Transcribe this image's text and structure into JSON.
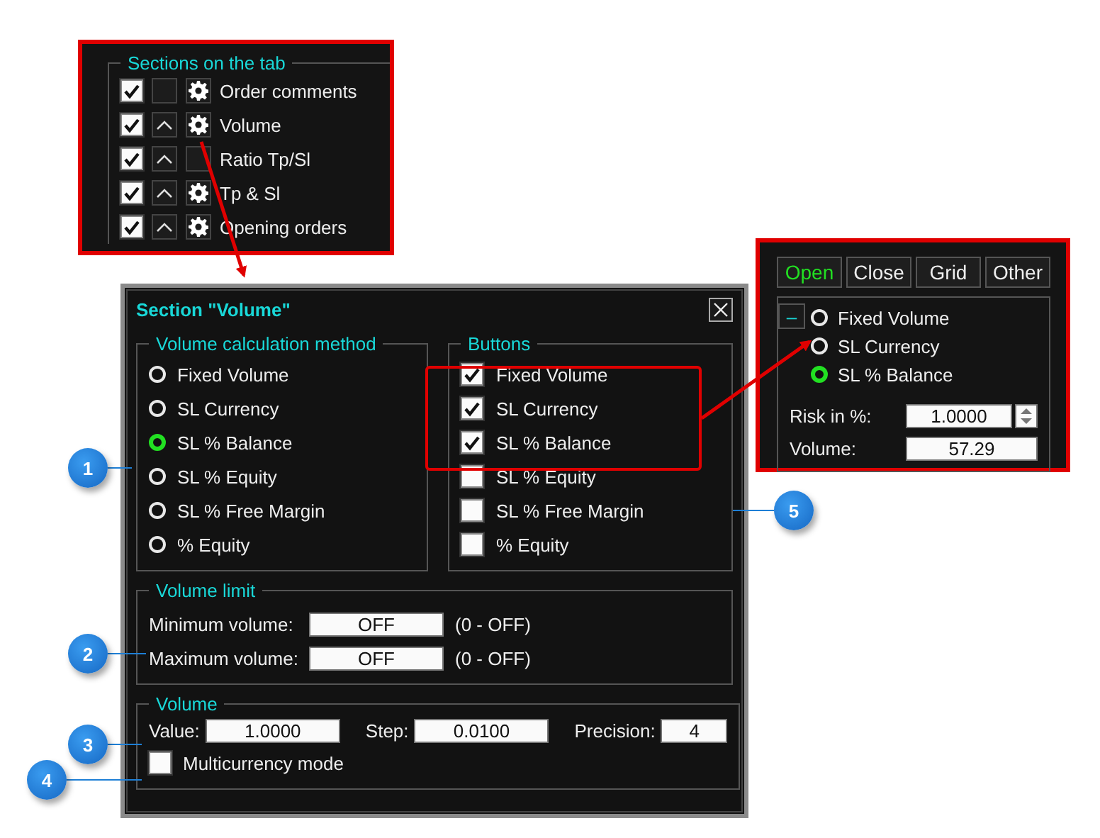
{
  "sections_inset": {
    "title": "Sections on the tab",
    "rows": [
      {
        "label": "Order comments",
        "checked": true,
        "arrow": false,
        "settings": true
      },
      {
        "label": "Volume",
        "checked": true,
        "arrow": true,
        "settings": true
      },
      {
        "label": "Ratio Tp/Sl",
        "checked": true,
        "arrow": true,
        "settings": false
      },
      {
        "label": "Tp & Sl",
        "checked": true,
        "arrow": true,
        "settings": true
      },
      {
        "label": "Opening orders",
        "checked": true,
        "arrow": true,
        "settings": true
      }
    ]
  },
  "dialog": {
    "title": "Section \"Volume\"",
    "method": {
      "title": "Volume calculation method",
      "options": [
        {
          "label": "Fixed Volume",
          "selected": false
        },
        {
          "label": "SL Currency",
          "selected": false
        },
        {
          "label": "SL % Balance",
          "selected": true
        },
        {
          "label": "SL % Equity",
          "selected": false
        },
        {
          "label": "SL % Free Margin",
          "selected": false
        },
        {
          "label": "% Equity",
          "selected": false
        }
      ]
    },
    "buttons": {
      "title": "Buttons",
      "items": [
        {
          "label": "Fixed Volume",
          "checked": true
        },
        {
          "label": "SL Currency",
          "checked": true
        },
        {
          "label": "SL % Balance",
          "checked": true
        },
        {
          "label": "SL % Equity",
          "checked": false
        },
        {
          "label": "SL % Free Margin",
          "checked": false
        },
        {
          "label": "% Equity",
          "checked": false
        }
      ]
    },
    "limit": {
      "title": "Volume limit",
      "rows": [
        {
          "label": "Minimum volume:",
          "value": "OFF",
          "hint": "(0 - OFF)"
        },
        {
          "label": "Maximum volume:",
          "value": "OFF",
          "hint": "(0 - OFF)"
        }
      ]
    },
    "volume": {
      "title": "Volume",
      "fields": [
        {
          "label": "Value:",
          "value": "1.0000"
        },
        {
          "label": "Step:",
          "value": "0.0100"
        },
        {
          "label": "Precision:",
          "value": "4"
        }
      ],
      "multicurrency": {
        "label": "Multicurrency mode",
        "checked": false
      }
    }
  },
  "panel_inset": {
    "tabs": [
      {
        "label": "Open",
        "selected": true
      },
      {
        "label": "Close",
        "selected": false
      },
      {
        "label": "Grid",
        "selected": false
      },
      {
        "label": "Other",
        "selected": false
      }
    ],
    "collapse": "–",
    "options": [
      {
        "label": "Fixed Volume",
        "selected": false
      },
      {
        "label": "SL Currency",
        "selected": false
      },
      {
        "label": "SL % Balance",
        "selected": true
      }
    ],
    "fields": [
      {
        "label": "Risk in %:",
        "value": "1.0000",
        "spinner": true
      },
      {
        "label": "Volume:",
        "value": "57.29",
        "spinner": false
      }
    ]
  },
  "callouts": [
    "1",
    "2",
    "3",
    "4",
    "5"
  ]
}
